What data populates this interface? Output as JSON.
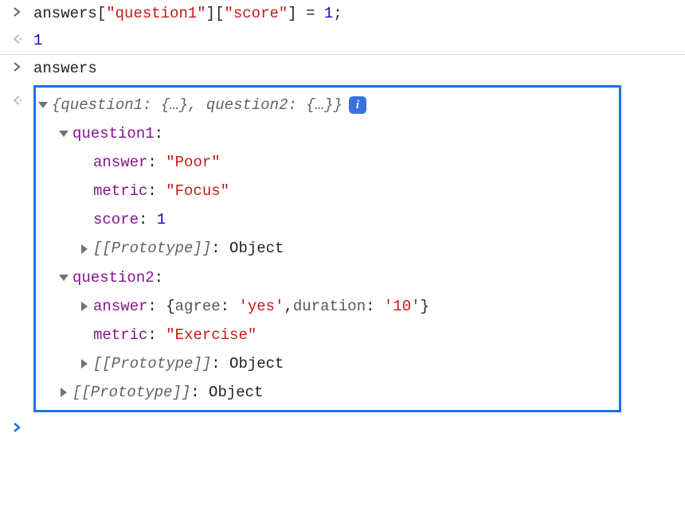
{
  "entries": {
    "input1": {
      "tokens": {
        "var": "answers",
        "key1": "\"question1\"",
        "key2": "\"score\"",
        "assign": " = ",
        "value": "1",
        "semi": ";",
        "lb": "[",
        "rb": "]"
      }
    },
    "output1": {
      "value": "1"
    },
    "input2": {
      "text": "answers"
    },
    "output2": {
      "summary": {
        "open": "{",
        "k1": "question1:",
        "v1": " {…}",
        "sep": ", ",
        "k2": "question2:",
        "v2": " {…}",
        "close": "}"
      },
      "q1_key": "question1",
      "q1_answer_k": "answer",
      "q1_answer_v": "\"Poor\"",
      "q1_metric_k": "metric",
      "q1_metric_v": "\"Focus\"",
      "q1_score_k": "score",
      "q1_score_v": "1",
      "proto_label": "[[Prototype]]",
      "proto_value": "Object",
      "q2_key": "question2",
      "q2_answer_k": "answer",
      "q2_answer_inline": {
        "open": "{",
        "k1": "agree",
        "v1": "'yes'",
        "sep": ", ",
        "k2": "duration",
        "v2": "'10'",
        "close": "}"
      },
      "q2_metric_k": "metric",
      "q2_metric_v": "\"Exercise\"",
      "colon": ":",
      "info": "i"
    }
  }
}
